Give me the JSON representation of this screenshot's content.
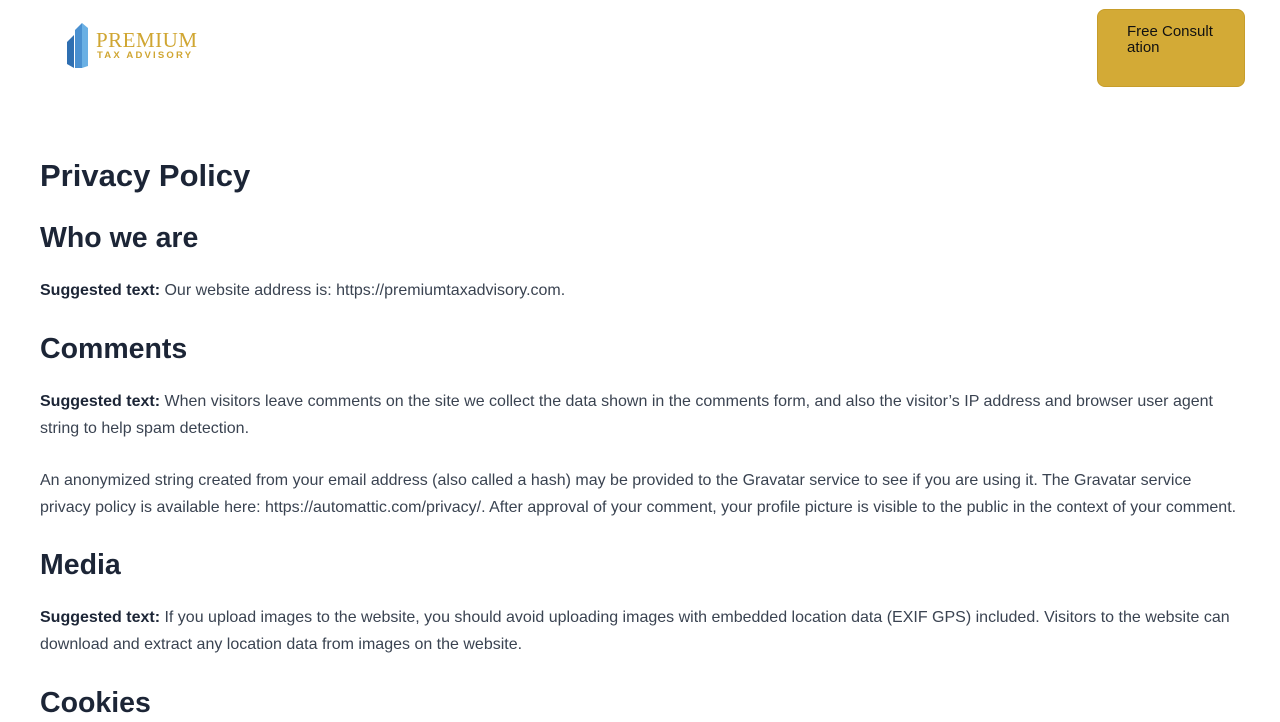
{
  "brand": {
    "name": "PREMIUM",
    "tagline": "TAX ADVISORY",
    "gold": "#d0a632",
    "blue_dark": "#2f6fb1",
    "blue_light": "#6ab0e4"
  },
  "header": {
    "cta_label": "Free Consultation"
  },
  "page": {
    "title": "Privacy Policy"
  },
  "sections": {
    "who": {
      "heading": "Who we are",
      "lead": "Suggested text:",
      "text": "Our website address is: https://premiumtaxadvisory.com."
    },
    "comments": {
      "heading": "Comments",
      "lead": "Suggested text:",
      "text": "When visitors leave comments on the site we collect the data shown in the comments form, and also the visitor’s IP address and browser user agent string to help spam detection.",
      "text2": "An anonymized string created from your email address (also called a hash) may be provided to the Gravatar service to see if you are using it. The Gravatar service privacy policy is available here: https://automattic.com/privacy/. After approval of your comment, your profile picture is visible to the public in the context of your comment."
    },
    "media": {
      "heading": "Media",
      "lead": "Suggested text:",
      "text": "If you upload images to the website, you should avoid uploading images with embedded location data (EXIF GPS) included. Visitors to the website can download and extract any location data from images on the website."
    },
    "cookies": {
      "heading": "Cookies"
    }
  }
}
